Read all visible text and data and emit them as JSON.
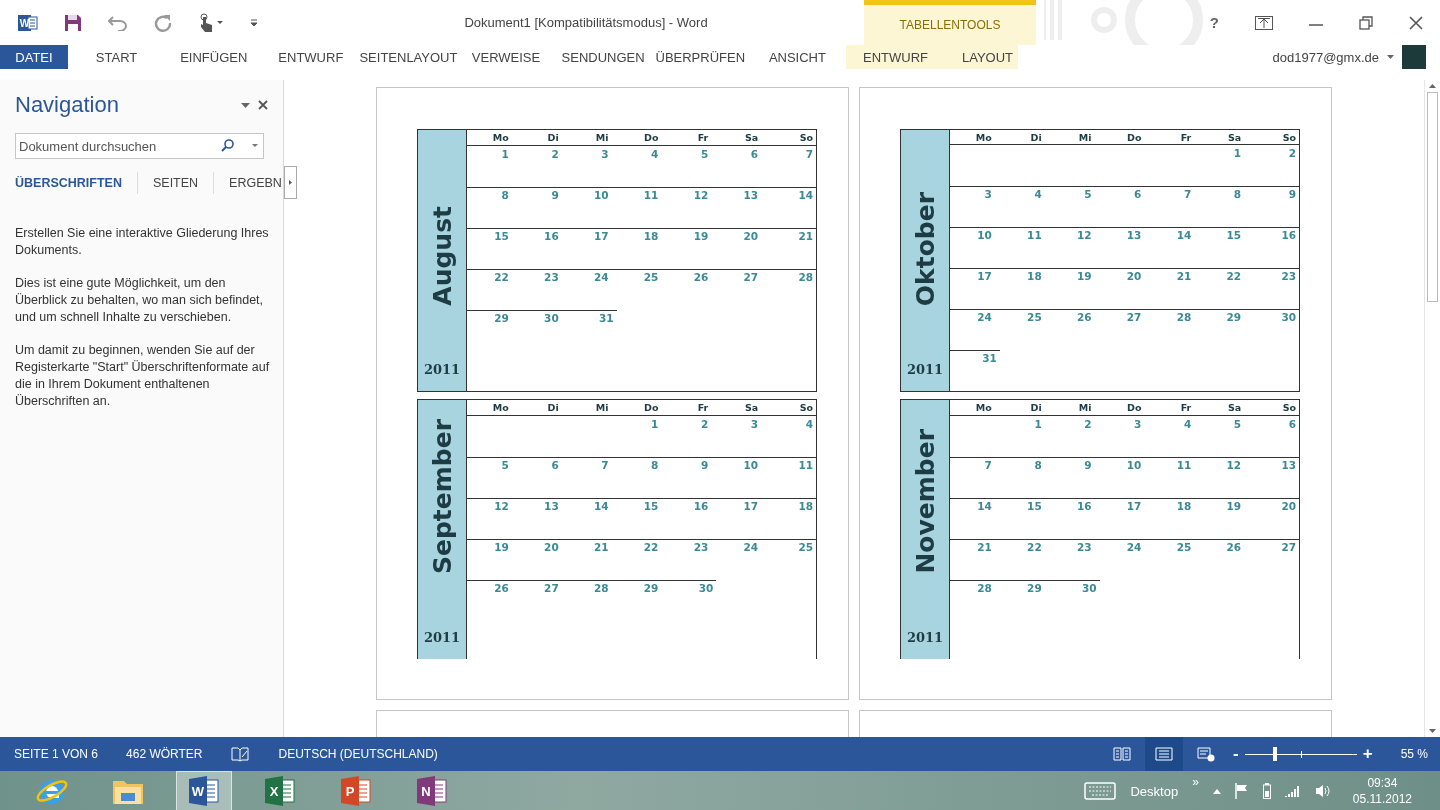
{
  "quick_access": {
    "app_letter": "W"
  },
  "window": {
    "title": "Dokument1 [Kompatibilitätsmodus] - Word"
  },
  "contextual_group": {
    "label": "TABELLENTOOLS"
  },
  "file_tab": {
    "label": "DATEI"
  },
  "ribbon_tabs": [
    {
      "label": "START",
      "selected": false,
      "kind": "main"
    },
    {
      "label": "EINFÜGEN",
      "selected": false,
      "kind": "main"
    },
    {
      "label": "ENTWURF",
      "selected": false,
      "kind": "main"
    },
    {
      "label": "SEITENLAYOUT",
      "selected": false,
      "kind": "main"
    },
    {
      "label": "VERWEISE",
      "selected": false,
      "kind": "main"
    },
    {
      "label": "SENDUNGEN",
      "selected": false,
      "kind": "main"
    },
    {
      "label": "ÜBERPRÜFEN",
      "selected": false,
      "kind": "main"
    },
    {
      "label": "ANSICHT",
      "selected": false,
      "kind": "main"
    },
    {
      "label": "ENTWURF",
      "selected": false,
      "kind": "contextual"
    },
    {
      "label": "LAYOUT",
      "selected": false,
      "kind": "contextual"
    }
  ],
  "window_controls": {
    "help": "?"
  },
  "account": {
    "email": "dod1977@gmx.de"
  },
  "navigation": {
    "title": "Navigation",
    "search": {
      "placeholder": "Dokument durchsuchen"
    },
    "tabs": [
      {
        "label": "ÜBERSCHRIFTEN",
        "selected": true
      },
      {
        "label": "SEITEN",
        "selected": false
      },
      {
        "label": "ERGEBN",
        "selected": false
      }
    ],
    "paragraphs": [
      "Erstellen Sie eine interaktive Gliederung Ihres Dokuments.",
      "Dies ist eine gute Möglichkeit, um den Überblick zu behalten, wo man sich befindet, und um schnell Inhalte zu verschieben.",
      "Um damit zu beginnen, wenden Sie auf der Registerkarte \"Start\" Überschriftenformate auf die in Ihrem Dokument enthaltenen Überschriften an."
    ]
  },
  "pages": [
    {
      "months": [
        {
          "name": "August",
          "year": "2011",
          "weekdays": [
            "Mo",
            "Di",
            "Mi",
            "Do",
            "Fr",
            "Sa",
            "So"
          ],
          "weeks": [
            {
              "kind": "first",
              "days": [
                "1",
                "2",
                "3",
                "4",
                "5",
                "6",
                "7"
              ]
            },
            {
              "kind": "full",
              "days": [
                "8",
                "9",
                "10",
                "11",
                "12",
                "13",
                "14"
              ]
            },
            {
              "kind": "full",
              "days": [
                "15",
                "16",
                "17",
                "18",
                "19",
                "20",
                "21"
              ]
            },
            {
              "kind": "full",
              "days": [
                "22",
                "23",
                "24",
                "25",
                "26",
                "27",
                "28"
              ]
            },
            {
              "kind": "last",
              "days": [
                "29",
                "30",
                "31"
              ]
            }
          ]
        },
        {
          "name": "September",
          "year": "2011",
          "weekdays": [
            "Mo",
            "Di",
            "Mi",
            "Do",
            "Fr",
            "Sa",
            "So"
          ],
          "weeks": [
            {
              "kind": "first",
              "days": [
                "1",
                "2",
                "3",
                "4"
              ]
            },
            {
              "kind": "full",
              "days": [
                "5",
                "6",
                "7",
                "8",
                "9",
                "10",
                "11"
              ]
            },
            {
              "kind": "full",
              "days": [
                "12",
                "13",
                "14",
                "15",
                "16",
                "17",
                "18"
              ]
            },
            {
              "kind": "full",
              "days": [
                "19",
                "20",
                "21",
                "22",
                "23",
                "24",
                "25"
              ]
            },
            {
              "kind": "last",
              "days": [
                "26",
                "27",
                "28",
                "29",
                "30"
              ]
            }
          ]
        }
      ]
    },
    {
      "months": [
        {
          "name": "Oktober",
          "year": "2011",
          "weekdays": [
            "Mo",
            "Di",
            "Mi",
            "Do",
            "Fr",
            "Sa",
            "So"
          ],
          "weeks": [
            {
              "kind": "first",
              "days": [
                "1",
                "2"
              ]
            },
            {
              "kind": "full",
              "days": [
                "3",
                "4",
                "5",
                "6",
                "7",
                "8",
                "9"
              ]
            },
            {
              "kind": "full",
              "days": [
                "10",
                "11",
                "12",
                "13",
                "14",
                "15",
                "16"
              ]
            },
            {
              "kind": "full",
              "days": [
                "17",
                "18",
                "19",
                "20",
                "21",
                "22",
                "23"
              ]
            },
            {
              "kind": "full",
              "days": [
                "24",
                "25",
                "26",
                "27",
                "28",
                "29",
                "30"
              ]
            },
            {
              "kind": "last",
              "days": [
                "31"
              ]
            }
          ]
        },
        {
          "name": "November",
          "year": "2011",
          "weekdays": [
            "Mo",
            "Di",
            "Mi",
            "Do",
            "Fr",
            "Sa",
            "So"
          ],
          "weeks": [
            {
              "kind": "first",
              "days": [
                "1",
                "2",
                "3",
                "4",
                "5",
                "6"
              ]
            },
            {
              "kind": "full",
              "days": [
                "7",
                "8",
                "9",
                "10",
                "11",
                "12",
                "13"
              ]
            },
            {
              "kind": "full",
              "days": [
                "14",
                "15",
                "16",
                "17",
                "18",
                "19",
                "20"
              ]
            },
            {
              "kind": "full",
              "days": [
                "21",
                "22",
                "23",
                "24",
                "25",
                "26",
                "27"
              ]
            },
            {
              "kind": "last",
              "days": [
                "28",
                "29",
                "30"
              ]
            }
          ]
        }
      ]
    }
  ],
  "status_bar": {
    "page": "SEITE 1 VON 6",
    "words": "462 WÖRTER",
    "language": "DEUTSCH (DEUTSCHLAND)",
    "views": [
      {
        "kind": "read",
        "selected": false
      },
      {
        "kind": "print",
        "selected": true
      },
      {
        "kind": "web",
        "selected": false
      }
    ],
    "zoom": {
      "level": 0.27,
      "minus": "-",
      "plus": "+",
      "reading": "55 %"
    }
  },
  "taskbar": {
    "apps": [
      {
        "kind": "ie",
        "selected": false
      },
      {
        "kind": "explorer",
        "selected": false
      },
      {
        "kind": "office",
        "letter": "W",
        "color": "#2b579a",
        "selected": true
      },
      {
        "kind": "office",
        "letter": "X",
        "color": "#217346",
        "selected": false
      },
      {
        "kind": "office",
        "letter": "P",
        "color": "#d24726",
        "selected": false
      },
      {
        "kind": "office",
        "letter": "N",
        "color": "#80397b",
        "selected": false
      }
    ],
    "toolbar": "Desktop",
    "more": "»",
    "time": "09:34",
    "date": "05.11.2012"
  }
}
